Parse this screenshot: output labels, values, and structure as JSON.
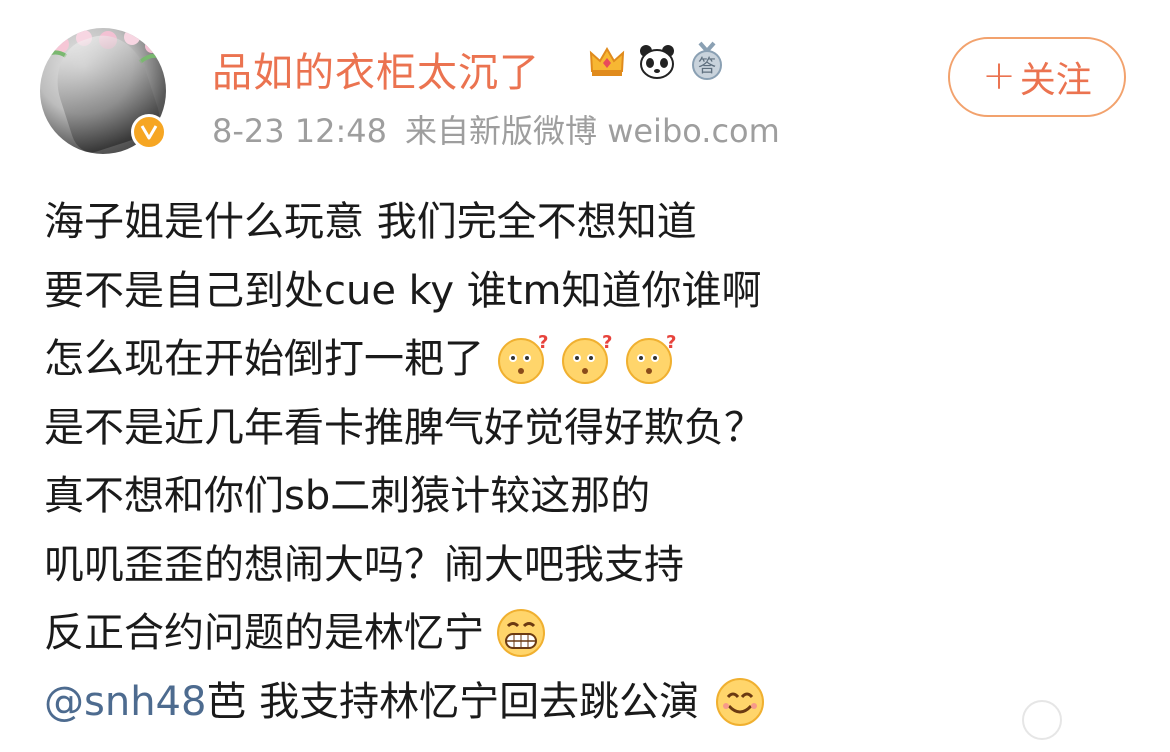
{
  "post": {
    "author": {
      "name": "品如的衣柜太沉了"
    },
    "badges": [
      "crown-badge-icon",
      "panda-badge-icon",
      "answer-medal-icon"
    ],
    "badge_text": "答",
    "time": "8-23 12:48",
    "source": "来自新版微博 weibo.com",
    "follow_label": "关注",
    "follow_plus": "+",
    "lines": {
      "l1": "海子姐是什么玩意 我们完全不想知道",
      "l2": "要不是自己到处cue ky 谁tm知道你谁啊",
      "l3": "怎么现在开始倒打一耙了",
      "l4": "是不是近几年看卡推脾气好觉得好欺负？",
      "l5": "真不想和你们sb二刺猿计较这那的",
      "l6": "叽叽歪歪的想闹大吗？闹大吧我支持",
      "l7": "反正合约问题的是林忆宁",
      "l8_mention": "@snh48",
      "l8_rest": " 芭 我支持林忆宁回去跳公演"
    },
    "emoji": [
      "confused-face-icon",
      "confused-face-icon",
      "confused-face-icon",
      "grin-face-icon",
      "smile-face-icon"
    ],
    "colors": {
      "name": "#eb7350",
      "mention": "#4d6b8f",
      "meta": "#9e9e9e",
      "follow_border": "#f2a26d",
      "verified": "#f6a623"
    }
  }
}
